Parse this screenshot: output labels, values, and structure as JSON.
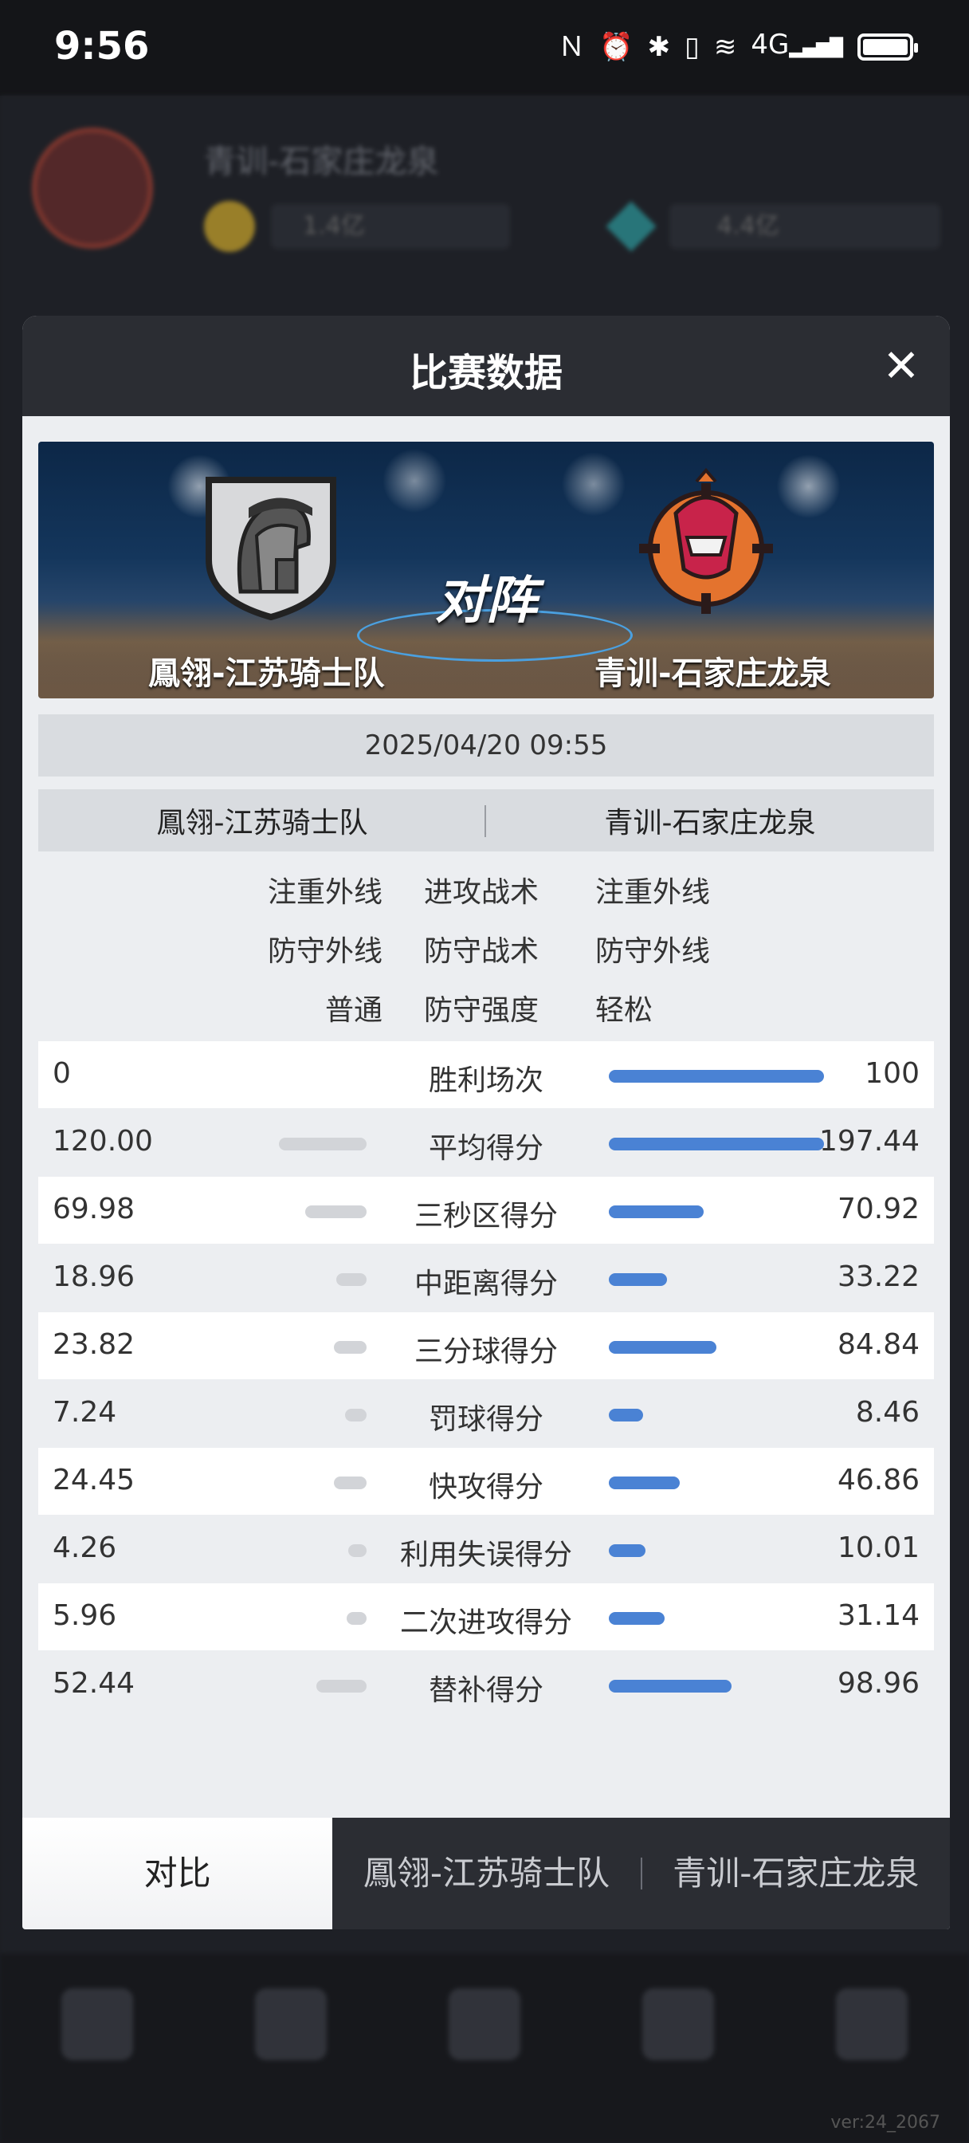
{
  "status_bar": {
    "time": "9:56",
    "network": "4G"
  },
  "background_app": {
    "title": "青训-石家庄龙泉",
    "coins": "1.4亿",
    "gems": "4.4亿",
    "version": "ver:24_2067"
  },
  "modal": {
    "title": "比赛数据",
    "close_symbol": "✕",
    "banner": {
      "vs_label": "对阵",
      "left_team": "鳳翎-江苏骑士队",
      "right_team": "青训-石家庄龙泉"
    },
    "date": "2025/04/20 09:55",
    "teams": {
      "left": "鳳翎-江苏骑士队",
      "right": "青训-石家庄龙泉"
    },
    "tactics": [
      {
        "left": "注重外线",
        "label": "进攻战术",
        "right": "注重外线"
      },
      {
        "left": "防守外线",
        "label": "防守战术",
        "right": "防守外线"
      },
      {
        "left": "普通",
        "label": "防守强度",
        "right": "轻松"
      }
    ],
    "stats": [
      {
        "label": "胜利场次",
        "left": "0",
        "right": "100",
        "left_ratio": 0.0,
        "right_ratio": 1.0
      },
      {
        "label": "平均得分",
        "left": "120.00",
        "right": "197.44",
        "left_ratio": 0.61,
        "right_ratio": 1.0
      },
      {
        "label": "三秒区得分",
        "left": "69.98",
        "right": "70.92",
        "left_ratio": 0.43,
        "right_ratio": 0.44
      },
      {
        "label": "中距离得分",
        "left": "18.96",
        "right": "33.22",
        "left_ratio": 0.21,
        "right_ratio": 0.27
      },
      {
        "label": "三分球得分",
        "left": "23.82",
        "right": "84.84",
        "left_ratio": 0.23,
        "right_ratio": 0.5
      },
      {
        "label": "罚球得分",
        "left": "7.24",
        "right": "8.46",
        "left_ratio": 0.15,
        "right_ratio": 0.16
      },
      {
        "label": "快攻得分",
        "left": "24.45",
        "right": "46.86",
        "left_ratio": 0.23,
        "right_ratio": 0.33
      },
      {
        "label": "利用失误得分",
        "left": "4.26",
        "right": "10.01",
        "left_ratio": 0.13,
        "right_ratio": 0.17
      },
      {
        "label": "二次进攻得分",
        "left": "5.96",
        "right": "31.14",
        "left_ratio": 0.14,
        "right_ratio": 0.26
      },
      {
        "label": "替补得分",
        "left": "52.44",
        "right": "98.96",
        "left_ratio": 0.35,
        "right_ratio": 0.57
      }
    ],
    "tabs": [
      {
        "label": "对比",
        "active": true
      },
      {
        "label": "鳳翎-江苏骑士队",
        "active": false
      },
      {
        "label": "青训-石家庄龙泉",
        "active": false
      }
    ]
  },
  "colors": {
    "accent_bar": "#4a82d4",
    "muted_bar": "#d2d4d8",
    "header_bg": "#2b2d33"
  }
}
